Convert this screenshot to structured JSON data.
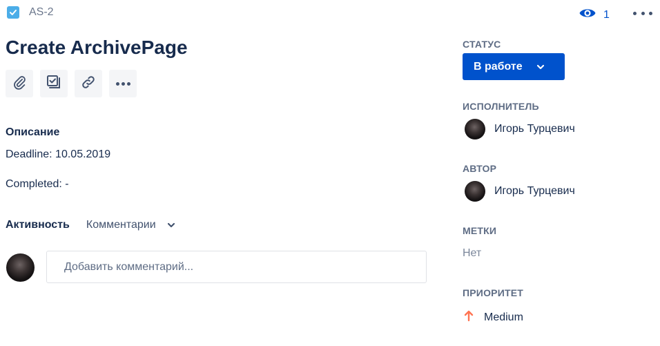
{
  "header": {
    "issue_key": "AS-2",
    "task_icon": "checkbox-icon",
    "watchers_count": "1",
    "watch_icon": "eye-icon",
    "more_icon": "more-icon"
  },
  "issue": {
    "title": "Create ArchivePage"
  },
  "toolbar": {
    "buttons": [
      {
        "name": "attach-button",
        "icon": "paperclip-icon"
      },
      {
        "name": "add-subtask-button",
        "icon": "subtask-icon"
      },
      {
        "name": "link-issue-button",
        "icon": "link-icon"
      },
      {
        "name": "more-actions-button",
        "icon": "more-icon"
      }
    ]
  },
  "description": {
    "label": "Описание",
    "lines": [
      "Deadline: 10.05.2019",
      "Completed: -"
    ]
  },
  "activity": {
    "label": "Активность",
    "filter_value": "Комментарии",
    "comment_placeholder": "Добавить комментарий..."
  },
  "sidebar": {
    "status": {
      "label": "СТАТУС",
      "value": "В работе"
    },
    "assignee": {
      "label": "ИСПОЛНИТЕЛЬ",
      "name": "Игорь Турцевич"
    },
    "reporter": {
      "label": "АВТОР",
      "name": "Игорь Турцевич"
    },
    "labels": {
      "label": "МЕТКИ",
      "value": "Нет"
    },
    "priority": {
      "label": "ПРИОРИТЕТ",
      "value": "Medium",
      "icon": "arrow-up-icon",
      "color": "#ff7452"
    }
  },
  "colors": {
    "primary": "#0052cc",
    "task_icon": "#4bade8",
    "text": "#172b4d",
    "muted": "#5e6c84"
  }
}
